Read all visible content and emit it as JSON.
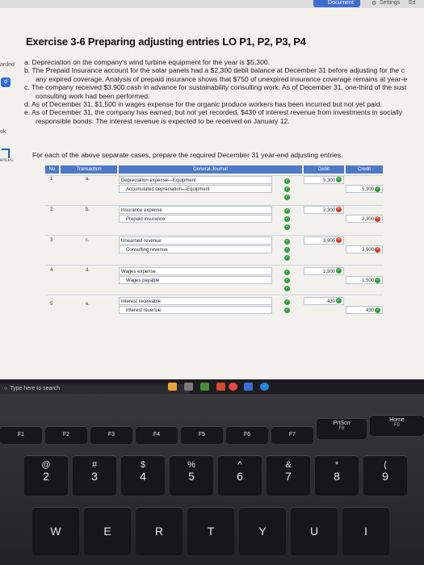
{
  "topbar": {
    "document_label": "Document",
    "settings_label": "Settings",
    "extra_label": "Ed"
  },
  "left_strip": {
    "item1": "arded",
    "item2": "d",
    "item3": "ok",
    "item4": "ences"
  },
  "exercise": {
    "title": "Exercise 3-6 Preparing adjusting entries LO P1, P2, P3, P4",
    "lines": [
      "a. Depreciation on the company's wind turbine equipment for the year is $5,300.",
      "b. The Prepaid Insurance account for the solar panels had a $2,300 debit balance at December 31 before adjusting for the c",
      "any expired coverage. Analysis of prepaid insurance shows that $750 of unexpired insurance coverage remains at year-e",
      "c. The company received $3,900 cash in advance for sustainability consulting work. As of December 31, one-third of the sust",
      "consulting work had been performed.",
      "d. As of December 31, $1,500 in wages expense for the organic produce workers has been incurred but not yet paid.",
      "e. As of December 31, the company has earned, but not yet recorded, $430 of interest revenue from investments in socially",
      "responsible bonds. The interest revenue is expected to be received on January 12."
    ],
    "instruction": "For each of the above separate cases, prepare the required December 31 year-end adjusting entries."
  },
  "journal": {
    "headers": {
      "no": "No",
      "transaction": "Transaction",
      "general_journal": "General Journal",
      "debit": "Debit",
      "credit": "Credit"
    },
    "entries": [
      {
        "no": "1",
        "transaction": "a.",
        "debit_account": "Depreciation expense—Equipment",
        "credit_account": "Accumulated depreciation—Equipment",
        "debit": "5,300",
        "credit": "5,300",
        "debit_status": "ok",
        "credit_status": "ok"
      },
      {
        "no": "2",
        "transaction": "b.",
        "debit_account": "Insurance expense",
        "credit_account": "Prepaid insurance",
        "debit": "2,300",
        "credit": "2,300",
        "debit_status": "error",
        "credit_status": "error"
      },
      {
        "no": "3",
        "transaction": "c.",
        "debit_account": "Unearned revenue",
        "credit_account": "Consulting revenue",
        "debit": "3,900",
        "credit": "3,900",
        "debit_status": "error",
        "credit_status": "error"
      },
      {
        "no": "4",
        "transaction": "d.",
        "debit_account": "Wages expense",
        "credit_account": "Wages payable",
        "debit": "1,500",
        "credit": "1,500",
        "debit_status": "ok",
        "credit_status": "ok"
      },
      {
        "no": "5",
        "transaction": "e.",
        "debit_account": "Interest receivable",
        "credit_account": "Interest revenue",
        "debit": "430",
        "credit": "430",
        "debit_status": "ok",
        "credit_status": "ok"
      }
    ]
  },
  "taskbar": {
    "search_placeholder": "Type here to search"
  },
  "keyboard": {
    "fn_row": [
      {
        "main": "F1",
        "sub": ""
      },
      {
        "main": "F2",
        "sub": ""
      },
      {
        "main": "F3",
        "sub": ""
      },
      {
        "main": "F4",
        "sub": ""
      },
      {
        "main": "F5",
        "sub": ""
      },
      {
        "main": "F6",
        "sub": ""
      },
      {
        "main": "F7",
        "sub": ""
      },
      {
        "main": "PrtScn",
        "sub": "F8"
      },
      {
        "main": "Home",
        "sub": "F9"
      }
    ],
    "num_row": [
      {
        "main": "2",
        "sub": "@"
      },
      {
        "main": "3",
        "sub": "#"
      },
      {
        "main": "4",
        "sub": "$"
      },
      {
        "main": "5",
        "sub": "%"
      },
      {
        "main": "6",
        "sub": "^"
      },
      {
        "main": "7",
        "sub": "&"
      },
      {
        "main": "8",
        "sub": "*"
      },
      {
        "main": "9",
        "sub": "("
      }
    ],
    "letter_row": [
      "W",
      "E",
      "R",
      "T",
      "Y",
      "U",
      "I"
    ]
  },
  "colors": {
    "header_blue": "#4d79c7",
    "ok_green": "#2f9e3a",
    "error_red": "#d63a2a"
  }
}
